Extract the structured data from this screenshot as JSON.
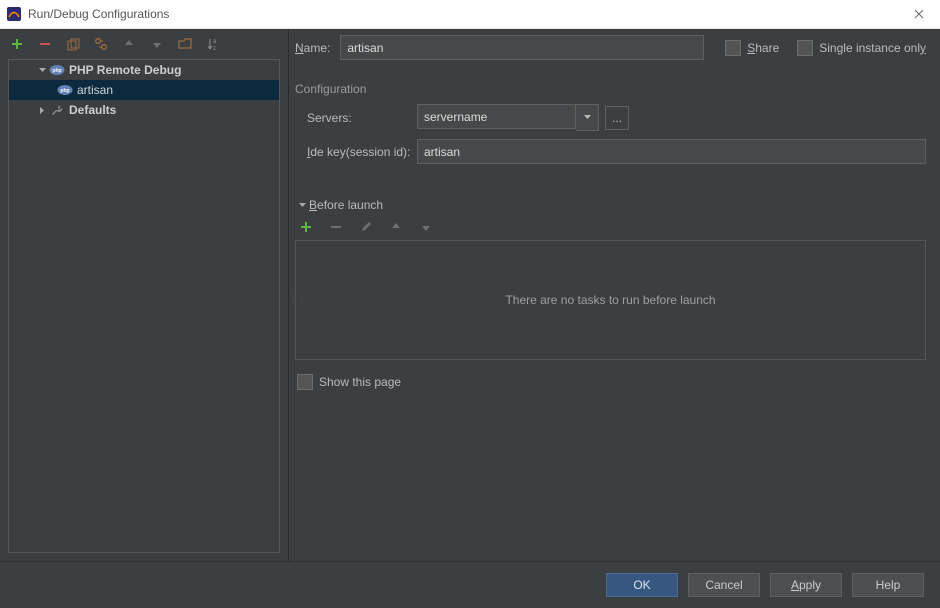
{
  "window": {
    "title": "Run/Debug Configurations"
  },
  "toolbar": {},
  "tree": {
    "php_remote_debug": "PHP Remote Debug",
    "artisan": "artisan",
    "defaults": "Defaults"
  },
  "form": {
    "name_label_prefix": "N",
    "name_label_rest": "ame:",
    "name_value": "artisan",
    "share_prefix": "S",
    "share_rest": "hare",
    "single_prefix": "Single instance onl",
    "single_suffix": "y",
    "config_section": "Configuration",
    "servers_label": "Servers:",
    "server_value": "servername",
    "ellipsis": "...",
    "idekey_prefix": "I",
    "idekey_rest": "de key(session id):",
    "idekey_value": "artisan",
    "before_launch_prefix": "B",
    "before_launch_rest": "efore launch",
    "no_tasks": "There are no tasks to run before launch",
    "show_this_page": "Show this page"
  },
  "buttons": {
    "ok": "OK",
    "cancel": "Cancel",
    "apply_prefix": "A",
    "apply_rest": "pply",
    "help": "Help"
  }
}
